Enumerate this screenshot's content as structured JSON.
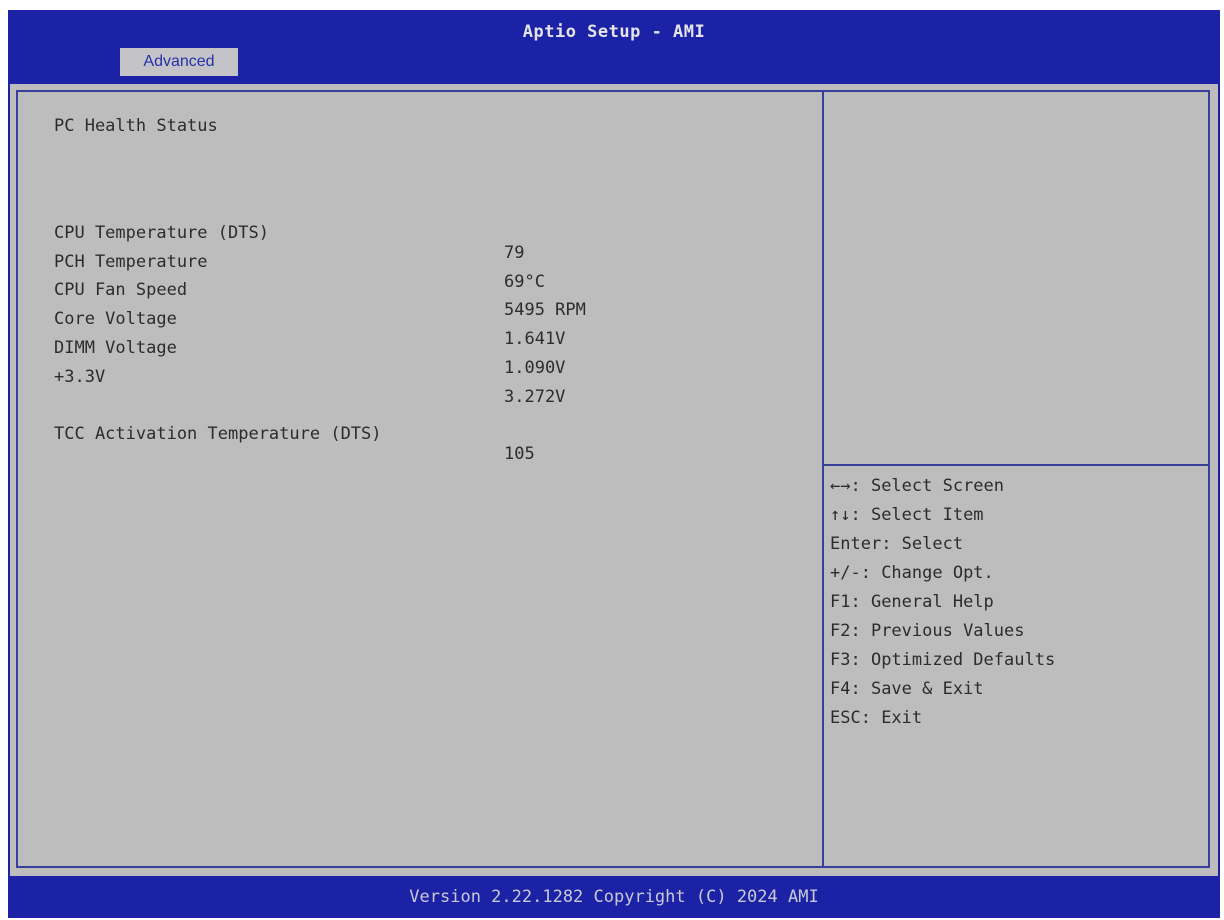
{
  "header": {
    "title": "Aptio Setup - AMI"
  },
  "tabs": [
    {
      "label": "Advanced"
    }
  ],
  "page": {
    "section_title": "PC Health Status",
    "rows": [
      {
        "label": "CPU Temperature (DTS)",
        "value": "79"
      },
      {
        "label": "PCH Temperature",
        "value": "69°C"
      },
      {
        "label": "CPU Fan Speed",
        "value": "5495 RPM"
      },
      {
        "label": "Core Voltage",
        "value": "1.641V"
      },
      {
        "label": "DIMM Voltage",
        "value": "1.090V"
      },
      {
        "label": "+3.3V",
        "value": "3.272V"
      },
      {
        "label": "TCC Activation Temperature (DTS)",
        "value": "105"
      }
    ]
  },
  "help": [
    {
      "key": "←→",
      "text": ": Select Screen"
    },
    {
      "key": "↑↓",
      "text": ": Select Item"
    },
    {
      "key": "Enter",
      "text": ": Select"
    },
    {
      "key": "+/-",
      "text": ": Change Opt."
    },
    {
      "key": "F1",
      "text": ": General Help"
    },
    {
      "key": "F2",
      "text": ": Previous Values"
    },
    {
      "key": "F3",
      "text": ": Optimized Defaults"
    },
    {
      "key": "F4",
      "text": ": Save & Exit"
    },
    {
      "key": "ESC",
      "text": ": Exit"
    }
  ],
  "footer": {
    "text": "Version 2.22.1282 Copyright (C) 2024 AMI"
  },
  "colors": {
    "frame_blue": "#1b22a6",
    "panel_gray": "#bdbdbe",
    "text_dark": "#2c2c2e",
    "border": "#3a3f9e"
  }
}
